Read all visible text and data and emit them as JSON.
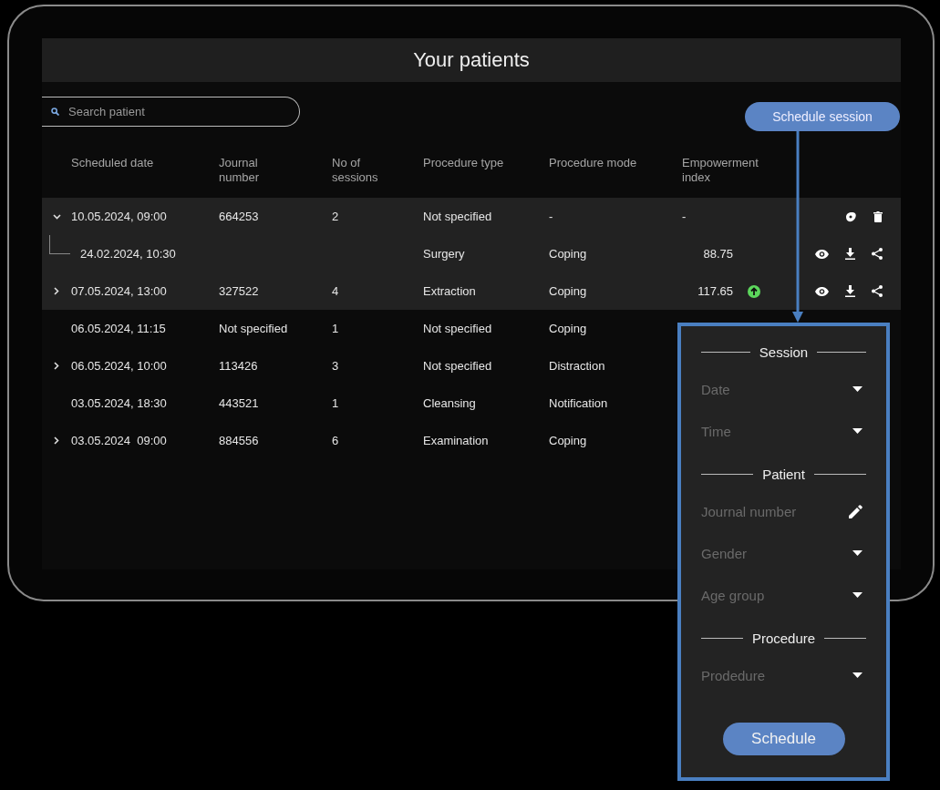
{
  "title": "Your patients",
  "search": {
    "placeholder": "Search patient"
  },
  "schedule_button": "Schedule session",
  "table": {
    "columns": [
      "Scheduled date",
      "Journal number",
      "No of sessions",
      "Procedure type",
      "Procedure mode",
      "Empowerment index"
    ],
    "rows": [
      {
        "expanded": true,
        "highlighted": true,
        "kind": "scheduled",
        "date": "10.05.2024, 09:00",
        "journal": "664253",
        "sessions": "2",
        "type": "Not specified",
        "mode": "-",
        "index": "-",
        "children": [
          {
            "highlighted": true,
            "kind": "completed",
            "date": "24.02.2024, 10:30",
            "type": "Surgery",
            "mode": "Coping",
            "index": "88.75"
          }
        ]
      },
      {
        "expanded": false,
        "highlighted": true,
        "kind": "completed",
        "improved": true,
        "date": "07.05.2024, 13:00",
        "journal": "327522",
        "sessions": "4",
        "type": "Extraction",
        "mode": "Coping",
        "index": "117.65"
      },
      {
        "highlighted": false,
        "date": "06.05.2024, 11:15",
        "journal": "Not specified",
        "sessions": "1",
        "type": "Not specified",
        "mode": "Coping"
      },
      {
        "expanded": false,
        "highlighted": false,
        "date": "06.05.2024, 10:00",
        "journal": "113426",
        "sessions": "3",
        "type": "Not specified",
        "mode": "Distraction"
      },
      {
        "highlighted": false,
        "date": "03.05.2024, 18:30",
        "journal": "443521",
        "sessions": "1",
        "type": "Cleansing",
        "mode": "Notification"
      },
      {
        "expanded": false,
        "highlighted": false,
        "date": "03.05.2024  09:00",
        "journal": "884556",
        "sessions": "6",
        "type": "Examination",
        "mode": "Coping"
      }
    ]
  },
  "popup": {
    "sections": [
      {
        "title": "Session",
        "fields": [
          {
            "kind": "dropdown",
            "placeholder": "Date"
          },
          {
            "kind": "dropdown",
            "placeholder": "Time"
          }
        ]
      },
      {
        "title": "Patient",
        "fields": [
          {
            "kind": "text",
            "placeholder": "Journal number"
          },
          {
            "kind": "dropdown",
            "placeholder": "Gender"
          },
          {
            "kind": "dropdown",
            "placeholder": "Age group"
          }
        ]
      },
      {
        "title": "Procedure",
        "fields": [
          {
            "kind": "dropdown",
            "placeholder": "Prodedure"
          }
        ]
      }
    ],
    "submit": "Schedule"
  }
}
